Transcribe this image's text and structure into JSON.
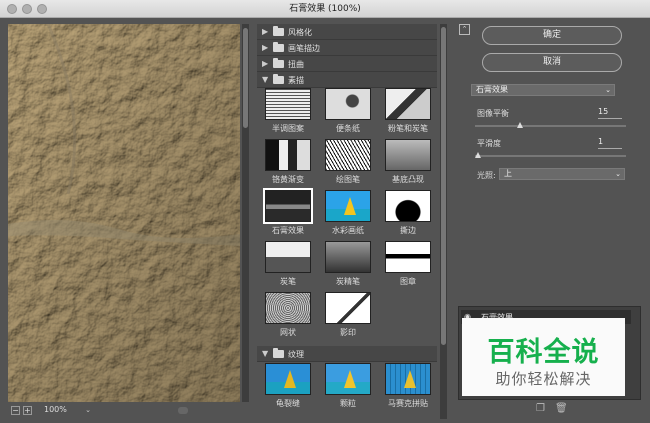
{
  "window": {
    "title": "石膏效果 (100%)"
  },
  "preview": {
    "zoom": "100%"
  },
  "gallery": {
    "folders": [
      {
        "label": "风格化",
        "expanded": false
      },
      {
        "label": "画笔描边",
        "expanded": false
      },
      {
        "label": "扭曲",
        "expanded": false
      },
      {
        "label": "素描",
        "expanded": true
      },
      {
        "label": "纹理",
        "expanded": true
      }
    ],
    "sketch_filters": [
      "半调图案",
      "便条纸",
      "粉笔和炭笔",
      "铬黄渐变",
      "绘图笔",
      "基底凸现",
      "石膏效果",
      "水彩画纸",
      "撕边",
      "炭笔",
      "炭精笔",
      "图章",
      "网状",
      "影印"
    ],
    "texture_filters": [
      "龟裂缝",
      "颗粒",
      "马赛克拼贴"
    ],
    "selected": "石膏效果"
  },
  "buttons": {
    "ok": "确定",
    "cancel": "取消"
  },
  "settings": {
    "filter_select": "石膏效果",
    "image_balance_label": "图像平衡",
    "image_balance_value": "15",
    "image_balance_max": 50,
    "smoothness_label": "平滑度",
    "smoothness_value": "1",
    "smoothness_max": 15,
    "light_label": "光照:",
    "light_value": "上"
  },
  "layers": {
    "item": "石膏效果"
  },
  "watermark": {
    "line1": "百科全说",
    "line2": "助你轻松解决"
  },
  "colors": {
    "accent_green": "#16b04d",
    "panel_bg": "#535353"
  }
}
